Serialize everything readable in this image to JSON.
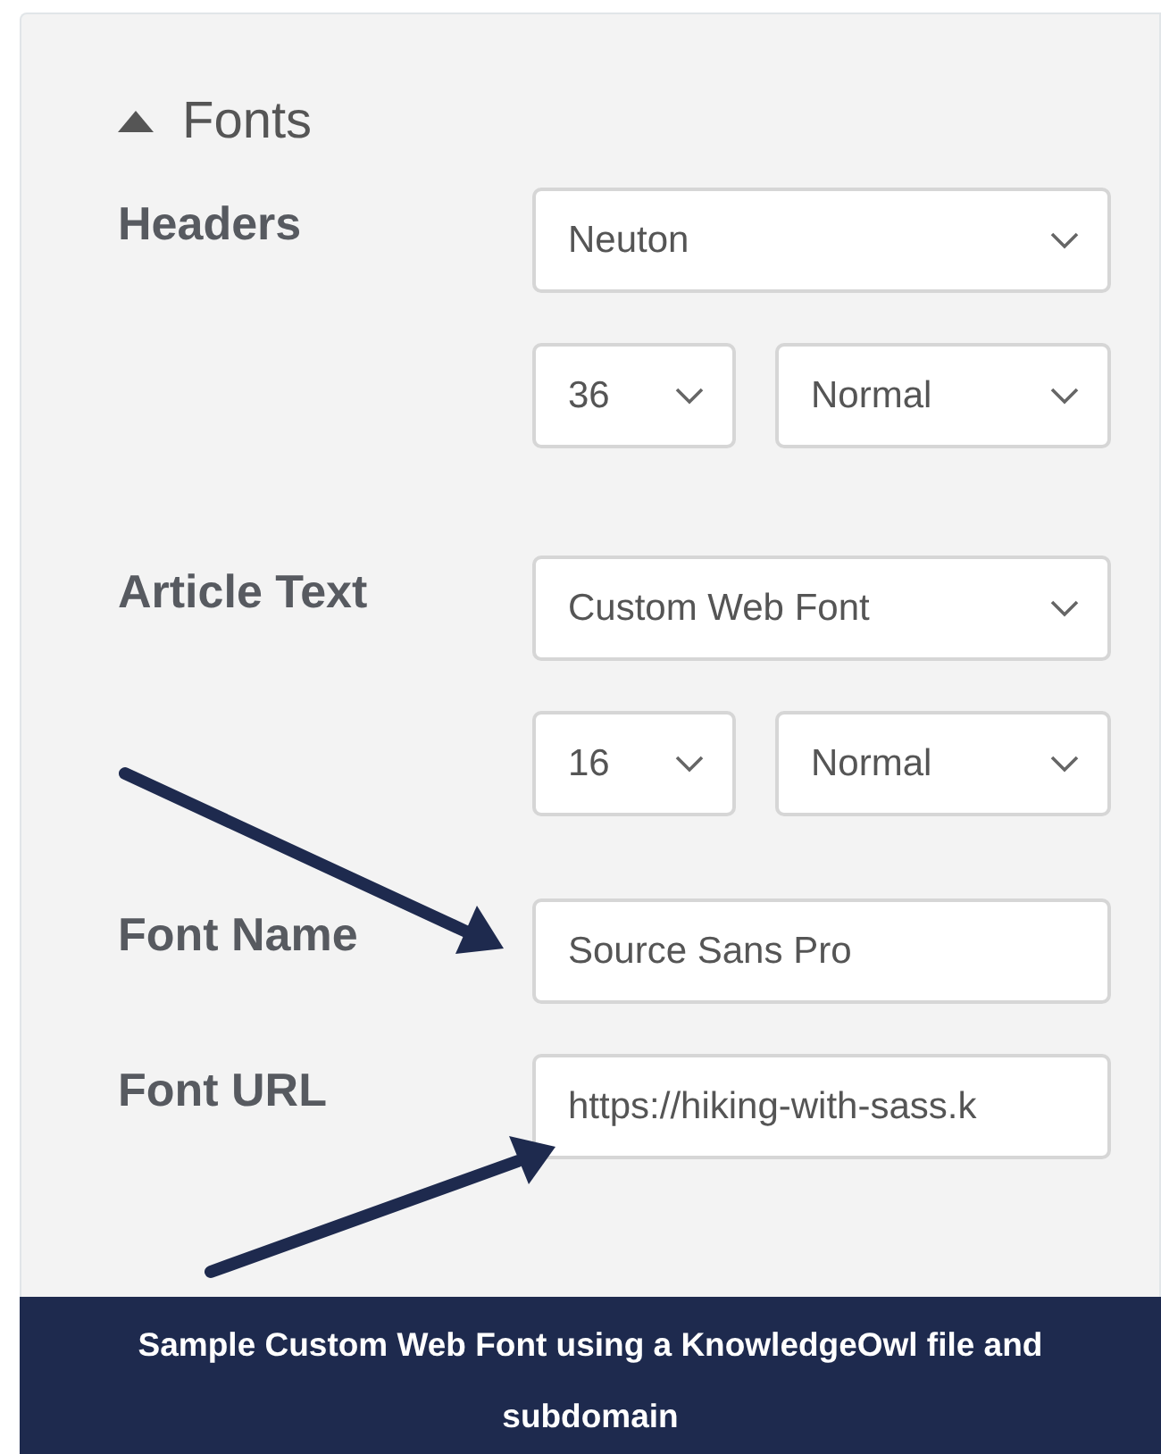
{
  "section": {
    "title": "Fonts",
    "expanded": true
  },
  "fields": [
    {
      "label": "Headers",
      "lines": [
        [
          {
            "kind": "select",
            "value": "Neuton"
          }
        ],
        [
          {
            "kind": "select",
            "value": "36"
          },
          {
            "kind": "select",
            "value": "Normal"
          }
        ]
      ]
    },
    {
      "label": "Article Text",
      "lines": [
        [
          {
            "kind": "select",
            "value": "Custom Web Font"
          }
        ],
        [
          {
            "kind": "select",
            "value": "16"
          },
          {
            "kind": "select",
            "value": "Normal"
          }
        ]
      ]
    },
    {
      "label": "Font Name",
      "lines": [
        [
          {
            "kind": "text",
            "value": "Source Sans Pro"
          }
        ]
      ]
    },
    {
      "label": "Font URL",
      "lines": [
        [
          {
            "kind": "text",
            "value": "https://hiking-with-sass.k"
          }
        ]
      ]
    }
  ],
  "caption": "Sample Custom Web Font using a KnowledgeOwl file and subdomain"
}
